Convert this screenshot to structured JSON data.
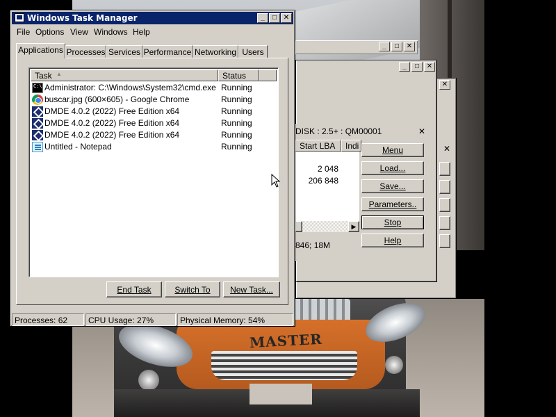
{
  "taskmanager": {
    "title": "Windows Task Manager",
    "menu": [
      "File",
      "Options",
      "View",
      "Windows",
      "Help"
    ],
    "tabs": [
      "Applications",
      "Processes",
      "Services",
      "Performance",
      "Networking",
      "Users"
    ],
    "active_tab": "Applications",
    "columns": {
      "task": "Task",
      "status": "Status"
    },
    "tasks": [
      {
        "name": "Administrator: C:\\Windows\\System32\\cmd.exe",
        "status": "Running",
        "icon": "cmd-icon"
      },
      {
        "name": "buscar.jpg (600×605) - Google Chrome",
        "status": "Running",
        "icon": "chrome-icon"
      },
      {
        "name": "DMDE 4.0.2 (2022) Free Edition x64",
        "status": "Running",
        "icon": "dmde-icon"
      },
      {
        "name": "DMDE 4.0.2 (2022) Free Edition x64",
        "status": "Running",
        "icon": "dmde-icon"
      },
      {
        "name": "DMDE 4.0.2 (2022) Free Edition x64",
        "status": "Running",
        "icon": "dmde-icon"
      },
      {
        "name": "Untitled - Notepad",
        "status": "Running",
        "icon": "notepad-icon"
      }
    ],
    "buttons": {
      "end_task": "End Task",
      "switch_to": "Switch To",
      "new_task": "New Task..."
    },
    "status": {
      "processes": "Processes: 62",
      "cpu": "CPU Usage: 27%",
      "memory": "Physical Memory: 54%"
    }
  },
  "dmde_dialog": {
    "title": "DISK : 2.5+ : QM00001",
    "column_start_lba": "Start LBA",
    "column_next": "Indi",
    "values": [
      "2 048",
      "206 848"
    ],
    "footer": "846; 18M",
    "buttons": [
      "Menu",
      "Load...",
      "Save...",
      "Parameters..",
      "Stop",
      "Help"
    ]
  },
  "background_photo": {
    "text": "MASTER"
  },
  "colors": {
    "titlebar_active": "#0a246a",
    "face": "#d4d0c8"
  }
}
